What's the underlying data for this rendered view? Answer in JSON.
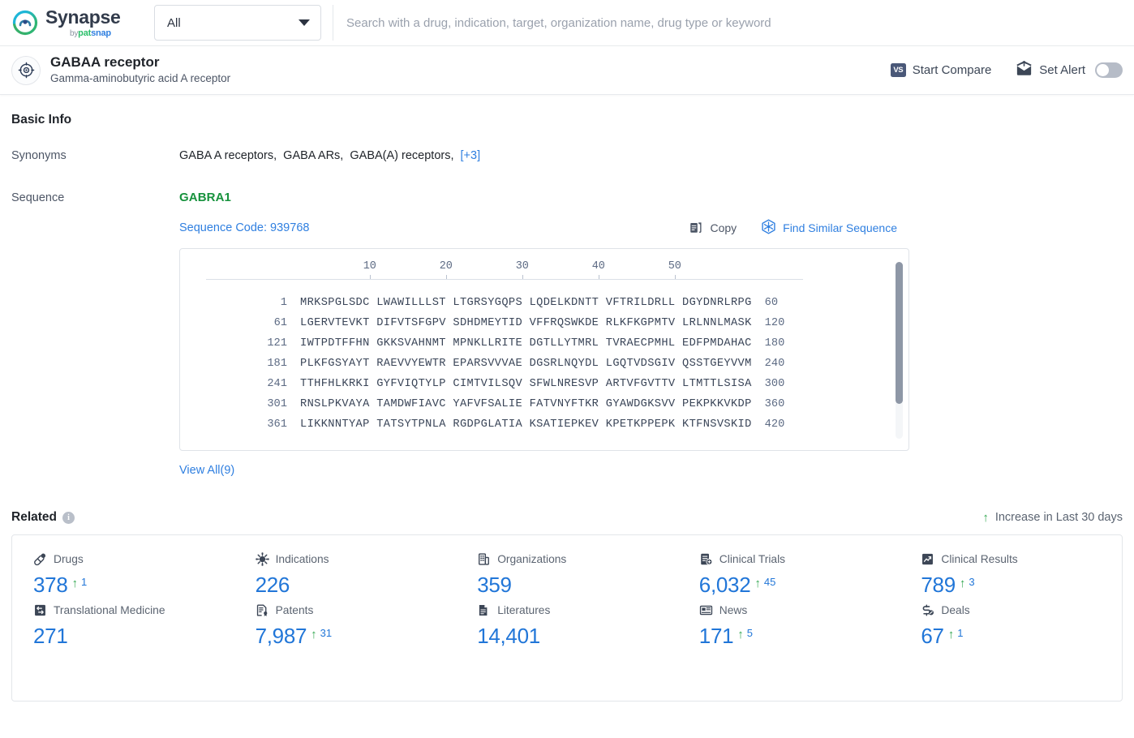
{
  "brand": {
    "name": "Synapse",
    "by": "by",
    "pat": "pat",
    "snap": "snap"
  },
  "search": {
    "scope_value": "All",
    "placeholder": "Search with a drug, indication, target, organization name, drug type or keyword",
    "value": ""
  },
  "entity": {
    "title": "GABAA receptor",
    "subtitle": "Gamma-aminobutyric acid A receptor",
    "icon": "target-icon",
    "actions": {
      "compare_badge": "VS",
      "compare_label": "Start Compare",
      "alert_label": "Set Alert",
      "alert_enabled": false
    }
  },
  "basic_info": {
    "section_title": "Basic Info",
    "synonyms_label": "Synonyms",
    "synonyms": [
      "GABA A receptors",
      "GABA ARs",
      "GABA(A) receptors"
    ],
    "synonyms_more": "[+3]",
    "sequence_label": "Sequence",
    "gene_name": "GABRA1",
    "sequence_code": "Sequence Code: 939768",
    "copy_label": "Copy",
    "find_similar_label": "Find Similar Sequence",
    "view_all": "View All(9)",
    "ruler_ticks": [
      10,
      20,
      30,
      40,
      50
    ],
    "rows": [
      {
        "start": "1",
        "letters": "MRKSPGLSDC LWAWILLLST LTGRSYGQPS LQDELKDNTT VFTRILDRLL DGYDNRLRPG",
        "end": "60"
      },
      {
        "start": "61",
        "letters": "LGERVTEVKT DIFVTSFGPV SDHDMEYTID VFFRQSWKDE RLKFKGPMTV LRLNNLMASK",
        "end": "120"
      },
      {
        "start": "121",
        "letters": "IWTPDTFFHN GKKSVAHNMT MPNKLLRITE DGTLLYTMRL TVRAECPMHL EDFPMDAHAC",
        "end": "180"
      },
      {
        "start": "181",
        "letters": "PLKFGSYAYT RAEVVYEWTR EPARSVVVAE DGSRLNQYDL LGQTVDSGIV QSSTGEYVVM",
        "end": "240"
      },
      {
        "start": "241",
        "letters": "TTHFHLKRKI GYFVIQTYLP CIMTVILSQV SFWLNRESVP ARTVFGVTTV LTMTTLSISA",
        "end": "300"
      },
      {
        "start": "301",
        "letters": "RNSLPKVAYA TAMDWFIAVC YAFVFSALIE FATVNYFTKR GYAWDGKSVV PEKPKKVKDP",
        "end": "360"
      },
      {
        "start": "361",
        "letters": "LIKKNNTYAP TATSYTPNLA RGDPGLATIA KSATIEPKEV KPETKPPEPK KTFNSVSKID",
        "end": "420"
      }
    ]
  },
  "related": {
    "title": "Related",
    "info_icon_char": "i",
    "legend": "Increase in Last 30 days",
    "stats": [
      {
        "label": "Drugs",
        "icon": "pill-icon",
        "value": "378",
        "delta": "1"
      },
      {
        "label": "Indications",
        "icon": "virus-icon",
        "value": "226",
        "delta": ""
      },
      {
        "label": "Organizations",
        "icon": "building-icon",
        "value": "359",
        "delta": ""
      },
      {
        "label": "Clinical Trials",
        "icon": "clinical-trial-icon",
        "value": "6,032",
        "delta": "45"
      },
      {
        "label": "Clinical Results",
        "icon": "clinical-result-icon",
        "value": "789",
        "delta": "3"
      },
      {
        "label": "Translational Medicine",
        "icon": "translational-icon",
        "value": "271",
        "delta": ""
      },
      {
        "label": "Patents",
        "icon": "patent-icon",
        "value": "7,987",
        "delta": "31"
      },
      {
        "label": "Literatures",
        "icon": "literature-icon",
        "value": "14,401",
        "delta": ""
      },
      {
        "label": "News",
        "icon": "news-icon",
        "value": "171",
        "delta": "5"
      },
      {
        "label": "Deals",
        "icon": "deal-icon",
        "value": "67",
        "delta": "1"
      }
    ]
  },
  "colors": {
    "link": "#2f7fe0",
    "stat_value": "#2176d8",
    "gene_green": "#17923d",
    "increase_green": "#35a853"
  }
}
